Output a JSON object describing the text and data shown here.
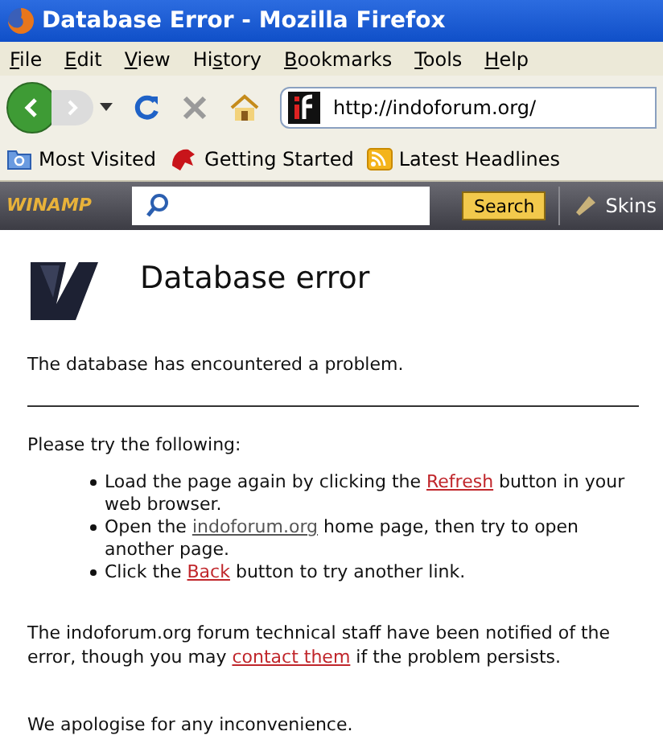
{
  "window": {
    "title": "Database Error - Mozilla Firefox"
  },
  "menu": [
    {
      "key": "F",
      "rest": "ile"
    },
    {
      "key": "E",
      "rest": "dit"
    },
    {
      "key": "V",
      "rest": "iew"
    },
    {
      "before": "Hi",
      "key": "s",
      "rest": "tory"
    },
    {
      "key": "B",
      "rest": "ookmarks"
    },
    {
      "key": "T",
      "rest": "ools"
    },
    {
      "key": "H",
      "rest": "elp"
    }
  ],
  "navigation": {
    "url": "http://indoforum.org/",
    "back_enabled": true,
    "forward_enabled": false
  },
  "bookmarks": [
    {
      "kind": "folder",
      "label": "Most Visited"
    },
    {
      "kind": "dog",
      "label": "Getting Started"
    },
    {
      "kind": "feed",
      "label": "Latest Headlines"
    }
  ],
  "winamp_bar": {
    "logo": "WINAMP",
    "search_button": "Search",
    "skins": "Skins"
  },
  "page": {
    "heading": "Database error",
    "intro": "The database has encountered a problem.",
    "prompt": "Please try the following:",
    "items": [
      [
        {
          "kind": "text",
          "text": "Load the page again by clicking the "
        },
        {
          "kind": "link",
          "text": "Refresh",
          "color": "#c0262b"
        },
        {
          "kind": "text",
          "text": " button in your web browser."
        }
      ],
      [
        {
          "kind": "text",
          "text": "Open the "
        },
        {
          "kind": "link",
          "text": "indoforum.org",
          "color": "#555555"
        },
        {
          "kind": "text",
          "text": " home page, then try to open another page."
        }
      ],
      [
        {
          "kind": "text",
          "text": "Click the "
        },
        {
          "kind": "link",
          "text": "Back",
          "color": "#c0262b"
        },
        {
          "kind": "text",
          "text": " button to try another link."
        }
      ]
    ],
    "notice": [
      {
        "kind": "text",
        "text": "The indoforum.org forum technical staff have been notified of the error, though you may "
      },
      {
        "kind": "link",
        "text": "contact them",
        "color": "#c0262b"
      },
      {
        "kind": "text",
        "text": " if the problem persists."
      }
    ],
    "apology": "We apologise for any inconvenience."
  }
}
